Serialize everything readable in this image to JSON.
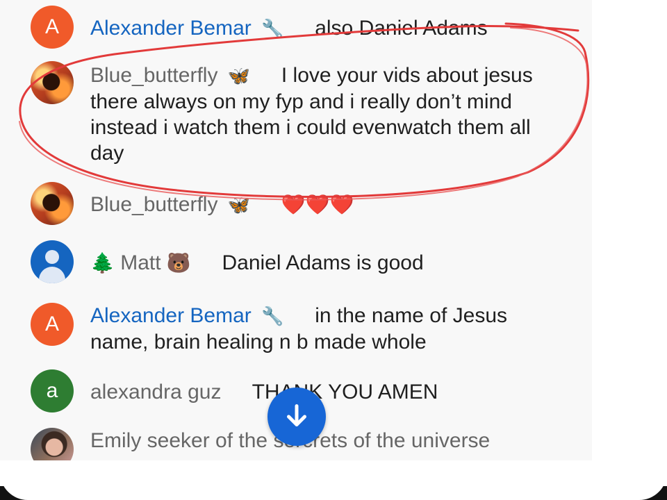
{
  "messages": [
    {
      "author": "Alexander Bemar",
      "badge_icon": "wrench-icon",
      "badge_glyph": "🔧",
      "text": "also Daniel Adams",
      "avatar_letter": "A",
      "avatar_color": "#f05a2a",
      "author_color": "#1565c0"
    },
    {
      "author": "Blue_butterfly",
      "badge_icon": "butterfly-icon",
      "badge_glyph": "🦋",
      "text": "I love your vids about jesus there always on my fyp and i really don’t mind instead i watch them i could evenwatch them all day",
      "avatar_letter": "",
      "author_color": "#666666"
    },
    {
      "author": "Blue_butterfly",
      "badge_icon": "butterfly-icon",
      "badge_glyph": "🦋",
      "text": "❤️❤️❤️",
      "avatar_letter": "",
      "author_color": "#666666"
    },
    {
      "author": "Matt",
      "prefix_glyph": "🌲",
      "badge_icon": "bear-icon",
      "badge_glyph": "🐻",
      "text": "Daniel Adams is good",
      "avatar_letter": "",
      "author_color": "#666666"
    },
    {
      "author": "Alexander Bemar",
      "badge_icon": "wrench-icon",
      "badge_glyph": "🔧",
      "text": "in the name of Jesus name, brain healing n b made whole",
      "avatar_letter": "A",
      "avatar_color": "#f05a2a",
      "author_color": "#1565c0"
    },
    {
      "author": "alexandra guz",
      "badge_icon": "",
      "badge_glyph": "",
      "text": "THANK YOU AMEN",
      "avatar_letter": "a",
      "avatar_color": "#2e7d32",
      "author_color": "#666666"
    },
    {
      "author": "Emily seeker of the sercrets of the universe",
      "badge_icon": "",
      "badge_glyph": "",
      "text": "",
      "avatar_letter": "",
      "author_color": "#666666"
    }
  ],
  "ui": {
    "accent_color": "#1766d6",
    "annotation_color": "#e23a3a",
    "scroll_button_icon": "arrow-down-icon"
  }
}
